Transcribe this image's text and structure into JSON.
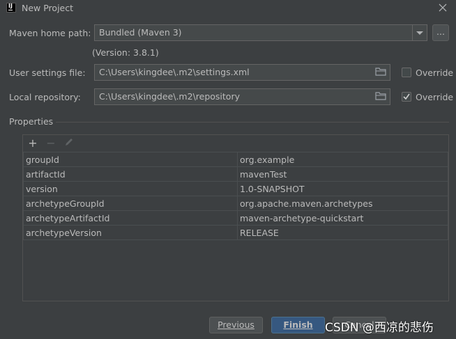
{
  "window": {
    "title": "New Project"
  },
  "maven_home": {
    "label": "Maven home path:",
    "value": "Bundled (Maven 3)",
    "browse_label": "...",
    "version": "(Version: 3.8.1)"
  },
  "user_settings": {
    "label": "User settings file:",
    "value": "C:\\Users\\kingdee\\.m2\\settings.xml",
    "override_label": "Override",
    "override_checked": false
  },
  "local_repo": {
    "label": "Local repository:",
    "value": "C:\\Users\\kingdee\\.m2\\repository",
    "override_label": "Override",
    "override_checked": true
  },
  "properties": {
    "section_label": "Properties",
    "toolbar": {
      "add": "+",
      "remove": "−"
    },
    "rows": [
      {
        "key": "groupId",
        "value": "org.example"
      },
      {
        "key": "artifactId",
        "value": "mavenTest"
      },
      {
        "key": "version",
        "value": "1.0-SNAPSHOT"
      },
      {
        "key": "archetypeGroupId",
        "value": "org.apache.maven.archetypes"
      },
      {
        "key": "archetypeArtifactId",
        "value": "maven-archetype-quickstart"
      },
      {
        "key": "archetypeVersion",
        "value": "RELEASE"
      }
    ]
  },
  "buttons": {
    "previous": "Previous",
    "finish": "Finish",
    "cancel": "Cancel"
  },
  "watermark": "CSDN @西凉的悲伤",
  "colors": {
    "background": "#3c3f41",
    "field": "#45494a",
    "primary": "#365880",
    "text": "#bbbbbb"
  }
}
